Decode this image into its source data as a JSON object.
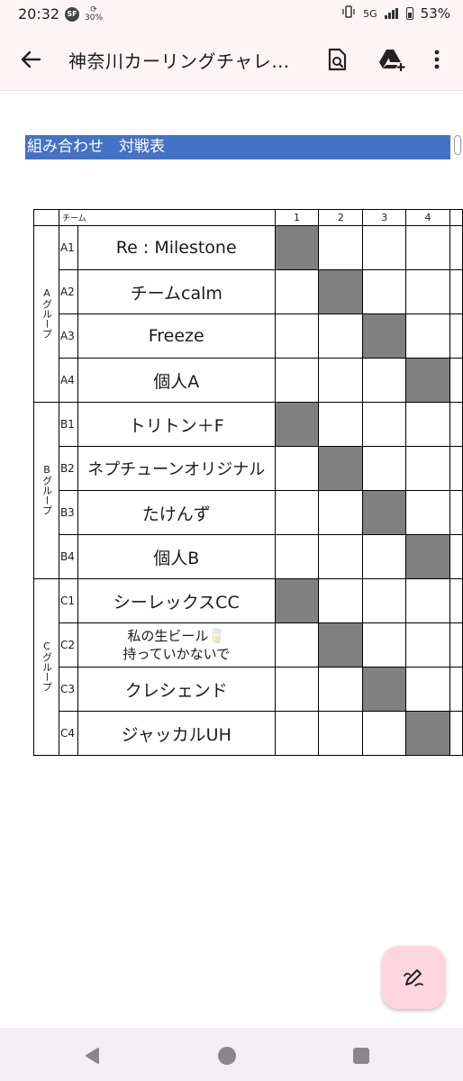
{
  "status_bar": {
    "time": "20:32",
    "sf_badge": "SF",
    "data_saver": "30%",
    "network": "5G",
    "battery": "53%"
  },
  "app_bar": {
    "title": "神奈川カーリングチャレ…"
  },
  "section_header": "組み合わせ　対戦表",
  "table": {
    "team_header": "チーム",
    "match_columns": [
      "1",
      "2",
      "3",
      "4"
    ],
    "groups": [
      {
        "label": "Aグループ",
        "teams": [
          {
            "id": "A1",
            "name": "Re : Milestone"
          },
          {
            "id": "A2",
            "name": "チームcalm"
          },
          {
            "id": "A3",
            "name": "Freeze"
          },
          {
            "id": "A4",
            "name": "個人A"
          }
        ]
      },
      {
        "label": "Bグループ",
        "teams": [
          {
            "id": "B1",
            "name": "トリトン＋F"
          },
          {
            "id": "B2",
            "name": "ネプチューンオリジナル"
          },
          {
            "id": "B3",
            "name": "たけんず"
          },
          {
            "id": "B4",
            "name": "個人B"
          }
        ]
      },
      {
        "label": "Cグループ",
        "teams": [
          {
            "id": "C1",
            "name": "シーレックスCC"
          },
          {
            "id": "C2",
            "name_line1": "私の生ビール🥛",
            "name_line2": "持っていかないで"
          },
          {
            "id": "C3",
            "name": "クレシェンド"
          },
          {
            "id": "C4",
            "name": "ジャッカルUH"
          }
        ]
      }
    ]
  },
  "colors": {
    "header_blue": "#4472c4",
    "cell_gray": "#808080",
    "app_bar_bg": "#fdf5f5",
    "fab_bg": "#ffd6e0"
  },
  "icons": {
    "back": "arrow-left-icon",
    "search_doc": "document-search-icon",
    "drive_add": "drive-add-icon",
    "more": "more-vertical-icon",
    "fab": "edit-pen-icon",
    "nav_back": "triangle-back-icon",
    "nav_home": "circle-home-icon",
    "nav_recents": "square-recents-icon"
  }
}
